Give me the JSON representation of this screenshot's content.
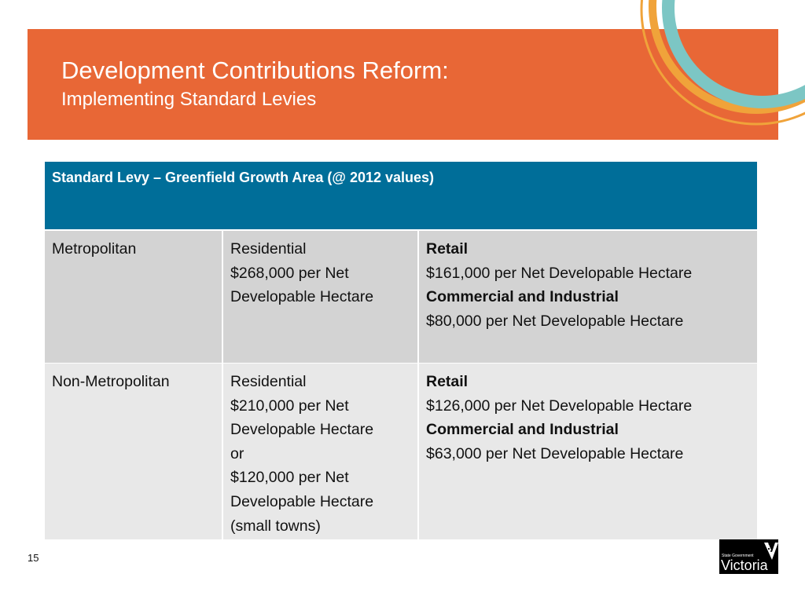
{
  "header": {
    "title": "Development Contributions Reform:",
    "subtitle": "Implementing Standard Levies"
  },
  "table": {
    "heading": "Standard Levy – Greenfield Growth Area (@ 2012 values)",
    "rows": [
      {
        "area": "Metropolitan",
        "residential": [
          "Residential",
          "$268,000 per Net",
          "Developable Hectare"
        ],
        "retail_label": "Retail",
        "retail_value": "$161,000 per Net Developable Hectare",
        "ci_label": "Commercial and Industrial",
        "ci_value": "$80,000 per Net Developable Hectare"
      },
      {
        "area": "Non-Metropolitan",
        "residential": [
          "Residential",
          "$210,000 per Net",
          "Developable Hectare",
          "or",
          "$120,000 per Net",
          "Developable Hectare",
          "(small towns)"
        ],
        "retail_label": "Retail",
        "retail_value": "$126,000 per Net Developable Hectare",
        "ci_label": "Commercial and Industrial",
        "ci_value": "$63,000 per Net Developable Hectare"
      }
    ]
  },
  "footer": {
    "page_number": "15",
    "logo_small": "State Government",
    "logo_big": "Victoria"
  },
  "colors": {
    "banner": "#E86736",
    "header": "#006E99",
    "teal": "#7CC6C4",
    "gold": "#F0A33A"
  }
}
